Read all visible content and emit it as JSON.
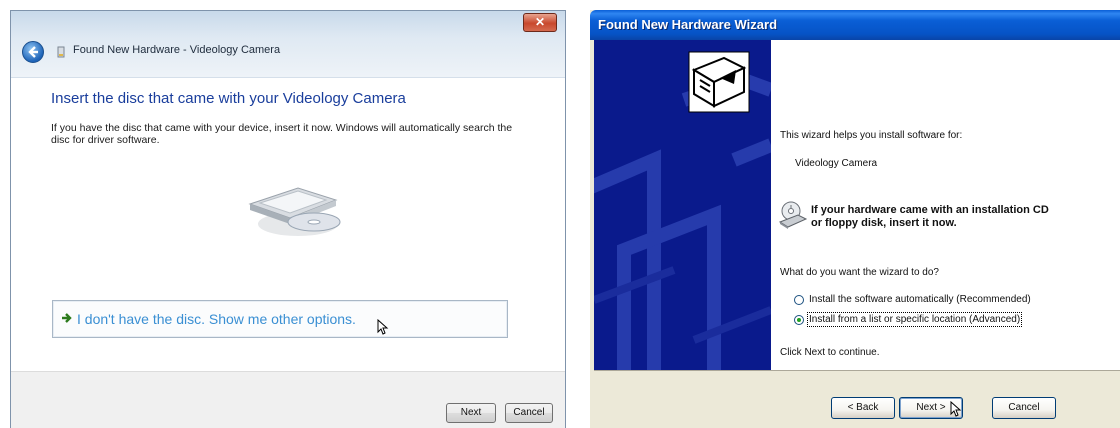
{
  "left_dialog": {
    "title": "Found New Hardware - Videology Camera",
    "heading": "Insert the disc that came with your Videology  Camera",
    "body": "If you have the disc that came with your device, insert it now.  Windows will automatically search the disc for driver software.",
    "option_link": "I don't have the disc. Show me other options.",
    "next_label": "Next",
    "cancel_label": "Cancel",
    "close_glyph": "✕"
  },
  "right_dialog": {
    "title": "Found New Hardware Wizard",
    "intro": "This wizard helps you install software for:",
    "device": "Videology  Camera",
    "cd_prompt_line1": "If your hardware came with an installation CD",
    "cd_prompt_line2": "or floppy disk, insert it now.",
    "question": "What do you want the wizard to do?",
    "options": [
      {
        "label": "Install the software automatically (Recommended)",
        "selected": false
      },
      {
        "label": "Install from a list or specific location (Advanced)",
        "selected": true
      }
    ],
    "continue_hint": "Click Next to continue.",
    "back_label": "< Back",
    "next_label": "Next >",
    "cancel_label": "Cancel"
  },
  "colors": {
    "vista_heading": "#1a3e9c",
    "vista_link": "#3a8fd3",
    "xp_titlebar": "#0a5fd6",
    "xp_side_panel": "#0a1a8c"
  }
}
